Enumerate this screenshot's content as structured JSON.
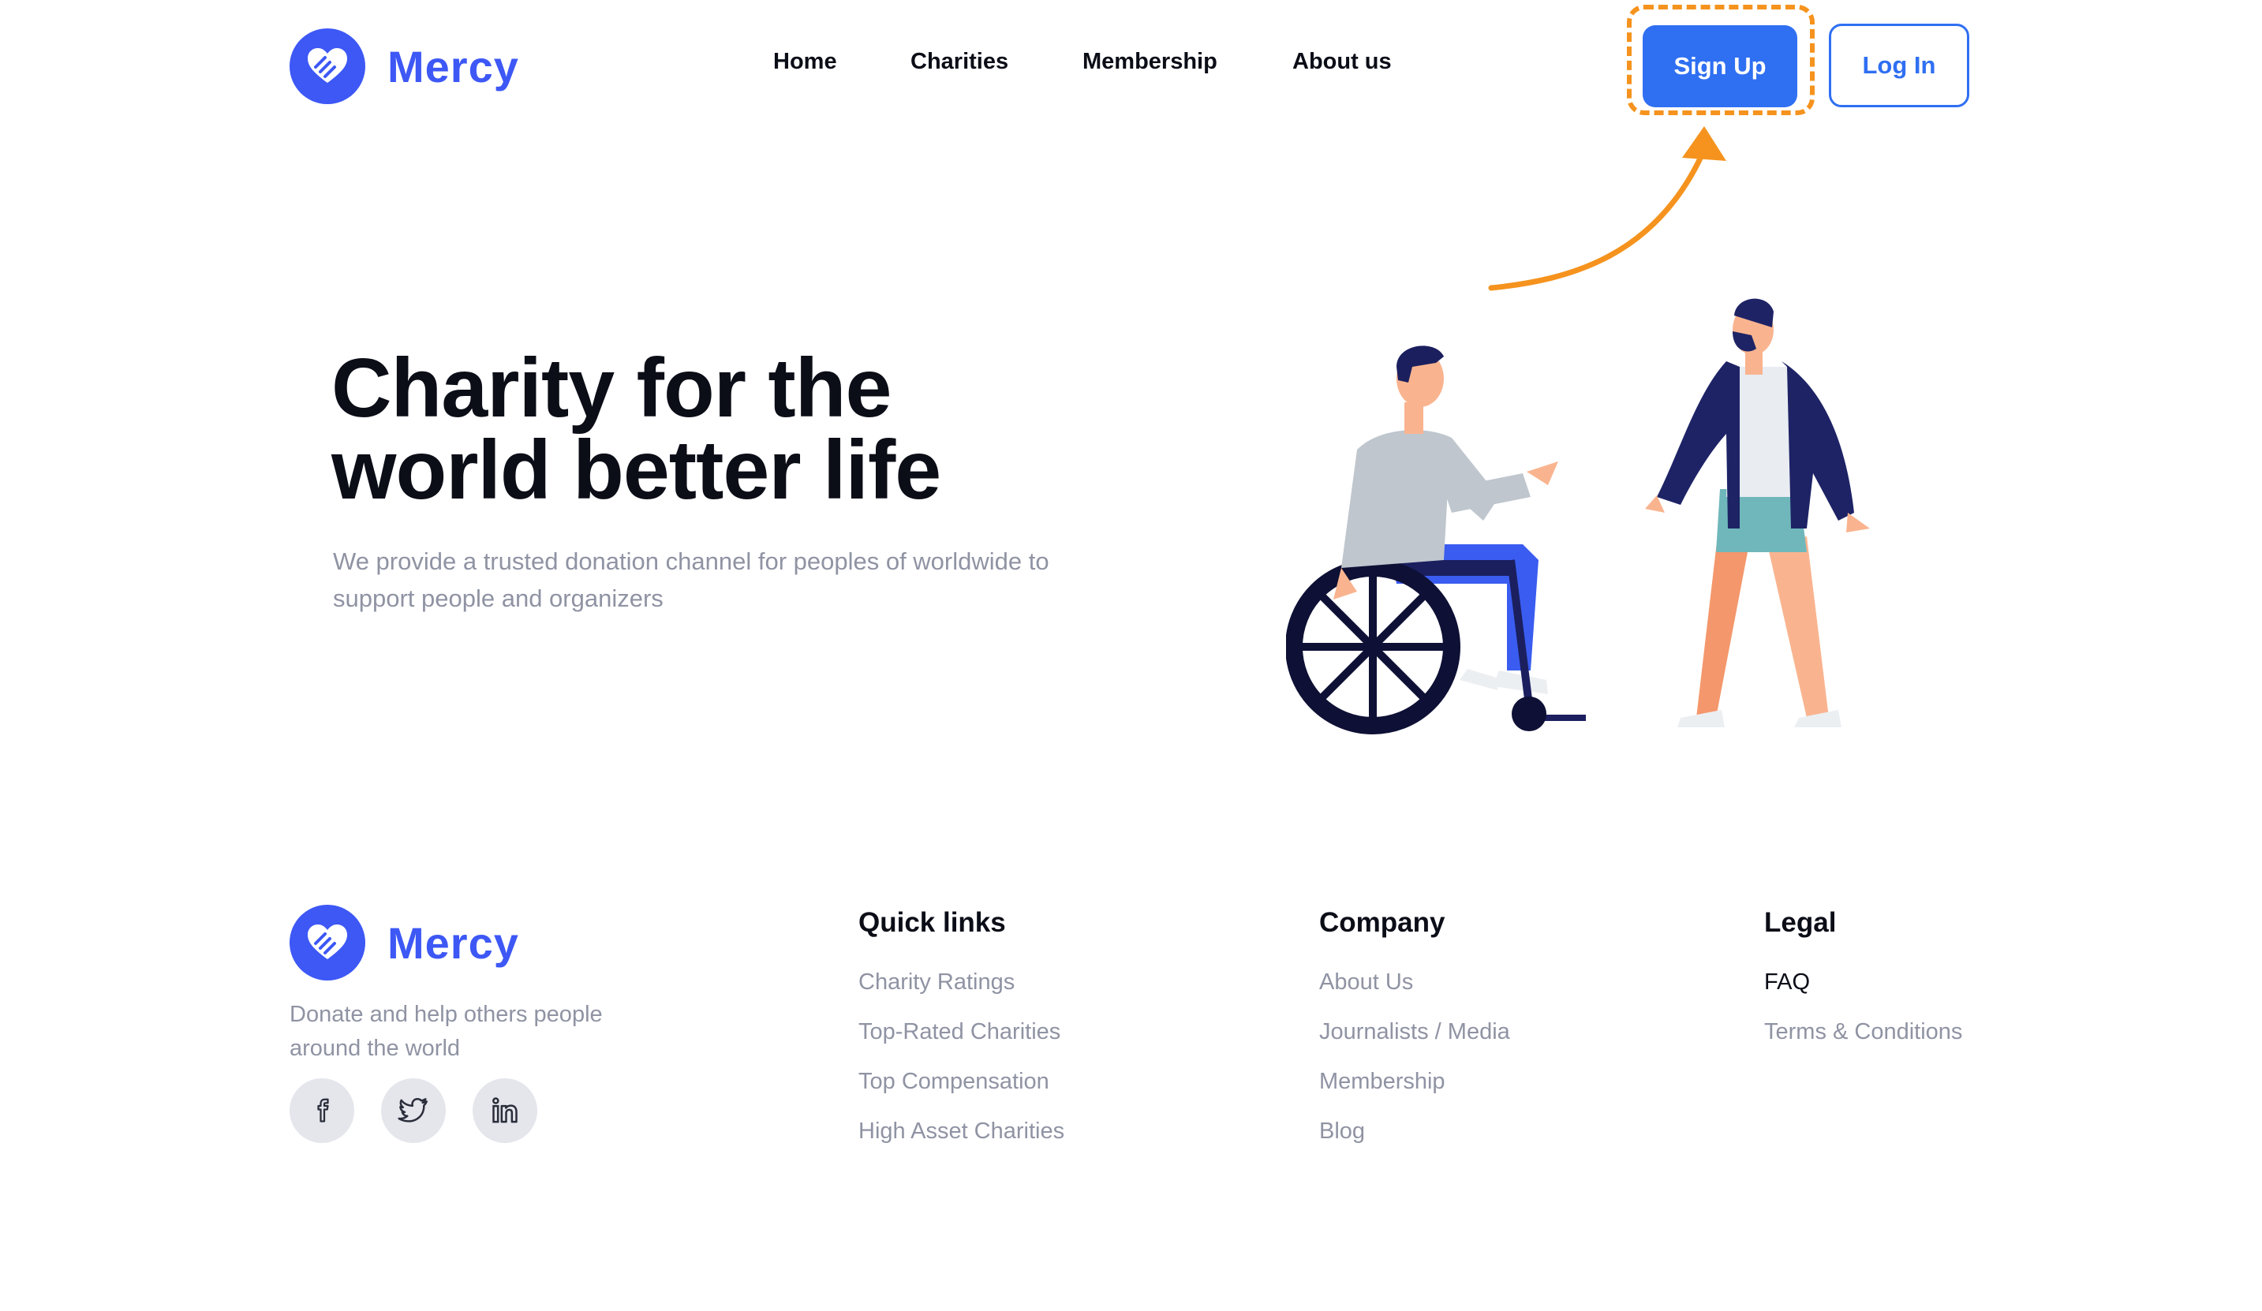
{
  "brand": {
    "name": "Mercy",
    "color": "#3d58f5"
  },
  "header": {
    "nav": [
      "Home",
      "Charities",
      "Membership",
      "About us"
    ],
    "signup_label": "Sign Up",
    "login_label": "Log In",
    "accent": "#2f6ff2",
    "highlight_color": "#f5931e"
  },
  "hero": {
    "title_line1": "Charity for the",
    "title_line2": "world better life",
    "subtitle_line1": "We provide a trusted donation channel for peoples of worldwide to",
    "subtitle_line2": "support people and organizers",
    "illustration": "person-in-wheelchair-and-walking-man-illustration"
  },
  "footer": {
    "tagline_line1": "Donate and help others people",
    "tagline_line2": "around the world",
    "socials": [
      "facebook-icon",
      "twitter-icon",
      "linkedin-icon"
    ],
    "quick_links": {
      "heading": "Quick links",
      "items": [
        "Charity Ratings",
        "Top-Rated Charities",
        "Top Compensation",
        "High Asset Charities"
      ]
    },
    "company": {
      "heading": "Company",
      "items": [
        "About Us",
        "Journalists / Media",
        "Membership",
        "Blog"
      ]
    },
    "legal": {
      "heading": "Legal",
      "items": [
        "FAQ",
        "Terms & Conditions"
      ]
    }
  }
}
